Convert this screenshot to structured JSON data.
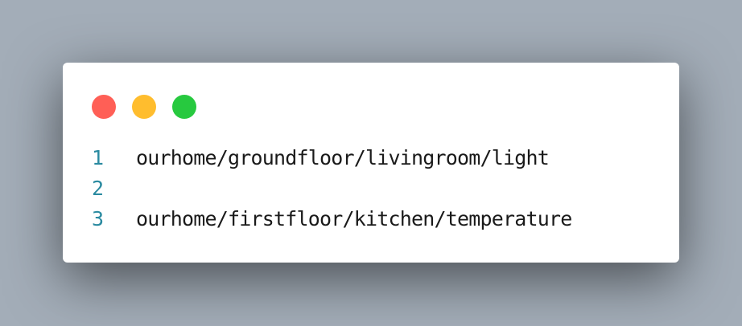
{
  "window": {
    "controls": [
      {
        "name": "close",
        "color": "#ff5f56"
      },
      {
        "name": "minimize",
        "color": "#ffbd2e"
      },
      {
        "name": "maximize",
        "color": "#27c93f"
      }
    ]
  },
  "code": {
    "lines": [
      {
        "number": "1",
        "text": "ourhome/groundfloor/livingroom/light"
      },
      {
        "number": "2",
        "text": ""
      },
      {
        "number": "3",
        "text": "ourhome/firstfloor/kitchen/temperature"
      }
    ]
  },
  "colors": {
    "background": "#a3adb8",
    "window": "#ffffff",
    "line_number": "#2a8aa0",
    "text": "#1a1a1a"
  }
}
